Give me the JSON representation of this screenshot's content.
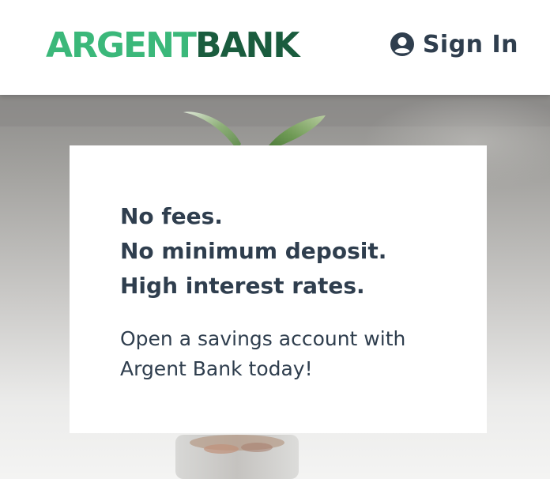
{
  "header": {
    "logo_part1": "ARGENT",
    "logo_part2": "BANK",
    "sign_in_label": "Sign In"
  },
  "hero": {
    "tagline": [
      "No fees.",
      "No minimum deposit.",
      "High interest rates."
    ],
    "description": "Open a savings account with Argent Bank today!"
  },
  "colors": {
    "logo_light_green": "#3bb87a",
    "logo_dark_green": "#1a5c3e",
    "text_dark": "#2f3e4e"
  },
  "icons": [
    "user-circle-icon"
  ]
}
